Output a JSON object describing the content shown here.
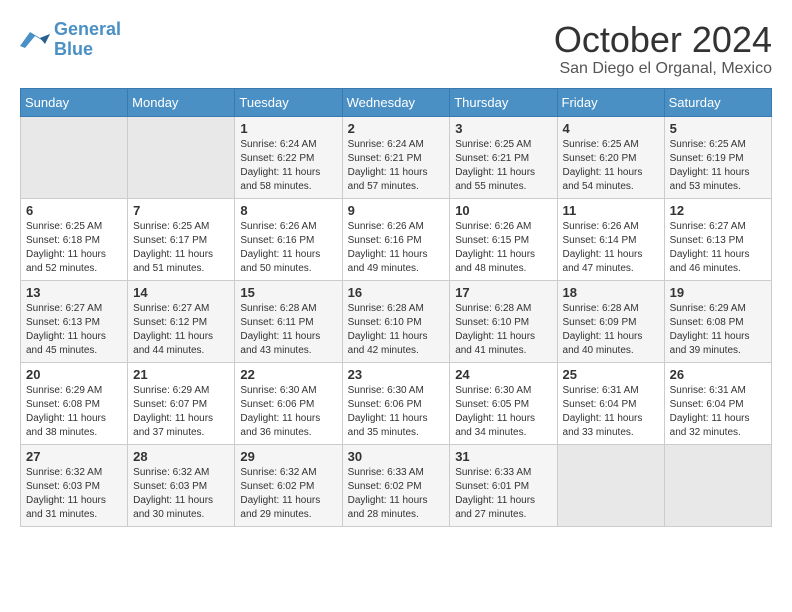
{
  "logo": {
    "line1": "General",
    "line2": "Blue"
  },
  "title": "October 2024",
  "subtitle": "San Diego el Organal, Mexico",
  "days_of_week": [
    "Sunday",
    "Monday",
    "Tuesday",
    "Wednesday",
    "Thursday",
    "Friday",
    "Saturday"
  ],
  "weeks": [
    [
      {
        "day": "",
        "empty": true
      },
      {
        "day": "",
        "empty": true
      },
      {
        "day": "1",
        "sunrise": "6:24 AM",
        "sunset": "6:22 PM",
        "daylight": "11 hours and 58 minutes."
      },
      {
        "day": "2",
        "sunrise": "6:24 AM",
        "sunset": "6:21 PM",
        "daylight": "11 hours and 57 minutes."
      },
      {
        "day": "3",
        "sunrise": "6:25 AM",
        "sunset": "6:21 PM",
        "daylight": "11 hours and 55 minutes."
      },
      {
        "day": "4",
        "sunrise": "6:25 AM",
        "sunset": "6:20 PM",
        "daylight": "11 hours and 54 minutes."
      },
      {
        "day": "5",
        "sunrise": "6:25 AM",
        "sunset": "6:19 PM",
        "daylight": "11 hours and 53 minutes."
      }
    ],
    [
      {
        "day": "6",
        "sunrise": "6:25 AM",
        "sunset": "6:18 PM",
        "daylight": "11 hours and 52 minutes."
      },
      {
        "day": "7",
        "sunrise": "6:25 AM",
        "sunset": "6:17 PM",
        "daylight": "11 hours and 51 minutes."
      },
      {
        "day": "8",
        "sunrise": "6:26 AM",
        "sunset": "6:16 PM",
        "daylight": "11 hours and 50 minutes."
      },
      {
        "day": "9",
        "sunrise": "6:26 AM",
        "sunset": "6:16 PM",
        "daylight": "11 hours and 49 minutes."
      },
      {
        "day": "10",
        "sunrise": "6:26 AM",
        "sunset": "6:15 PM",
        "daylight": "11 hours and 48 minutes."
      },
      {
        "day": "11",
        "sunrise": "6:26 AM",
        "sunset": "6:14 PM",
        "daylight": "11 hours and 47 minutes."
      },
      {
        "day": "12",
        "sunrise": "6:27 AM",
        "sunset": "6:13 PM",
        "daylight": "11 hours and 46 minutes."
      }
    ],
    [
      {
        "day": "13",
        "sunrise": "6:27 AM",
        "sunset": "6:13 PM",
        "daylight": "11 hours and 45 minutes."
      },
      {
        "day": "14",
        "sunrise": "6:27 AM",
        "sunset": "6:12 PM",
        "daylight": "11 hours and 44 minutes."
      },
      {
        "day": "15",
        "sunrise": "6:28 AM",
        "sunset": "6:11 PM",
        "daylight": "11 hours and 43 minutes."
      },
      {
        "day": "16",
        "sunrise": "6:28 AM",
        "sunset": "6:10 PM",
        "daylight": "11 hours and 42 minutes."
      },
      {
        "day": "17",
        "sunrise": "6:28 AM",
        "sunset": "6:10 PM",
        "daylight": "11 hours and 41 minutes."
      },
      {
        "day": "18",
        "sunrise": "6:28 AM",
        "sunset": "6:09 PM",
        "daylight": "11 hours and 40 minutes."
      },
      {
        "day": "19",
        "sunrise": "6:29 AM",
        "sunset": "6:08 PM",
        "daylight": "11 hours and 39 minutes."
      }
    ],
    [
      {
        "day": "20",
        "sunrise": "6:29 AM",
        "sunset": "6:08 PM",
        "daylight": "11 hours and 38 minutes."
      },
      {
        "day": "21",
        "sunrise": "6:29 AM",
        "sunset": "6:07 PM",
        "daylight": "11 hours and 37 minutes."
      },
      {
        "day": "22",
        "sunrise": "6:30 AM",
        "sunset": "6:06 PM",
        "daylight": "11 hours and 36 minutes."
      },
      {
        "day": "23",
        "sunrise": "6:30 AM",
        "sunset": "6:06 PM",
        "daylight": "11 hours and 35 minutes."
      },
      {
        "day": "24",
        "sunrise": "6:30 AM",
        "sunset": "6:05 PM",
        "daylight": "11 hours and 34 minutes."
      },
      {
        "day": "25",
        "sunrise": "6:31 AM",
        "sunset": "6:04 PM",
        "daylight": "11 hours and 33 minutes."
      },
      {
        "day": "26",
        "sunrise": "6:31 AM",
        "sunset": "6:04 PM",
        "daylight": "11 hours and 32 minutes."
      }
    ],
    [
      {
        "day": "27",
        "sunrise": "6:32 AM",
        "sunset": "6:03 PM",
        "daylight": "11 hours and 31 minutes."
      },
      {
        "day": "28",
        "sunrise": "6:32 AM",
        "sunset": "6:03 PM",
        "daylight": "11 hours and 30 minutes."
      },
      {
        "day": "29",
        "sunrise": "6:32 AM",
        "sunset": "6:02 PM",
        "daylight": "11 hours and 29 minutes."
      },
      {
        "day": "30",
        "sunrise": "6:33 AM",
        "sunset": "6:02 PM",
        "daylight": "11 hours and 28 minutes."
      },
      {
        "day": "31",
        "sunrise": "6:33 AM",
        "sunset": "6:01 PM",
        "daylight": "11 hours and 27 minutes."
      },
      {
        "day": "",
        "empty": true
      },
      {
        "day": "",
        "empty": true
      }
    ]
  ]
}
